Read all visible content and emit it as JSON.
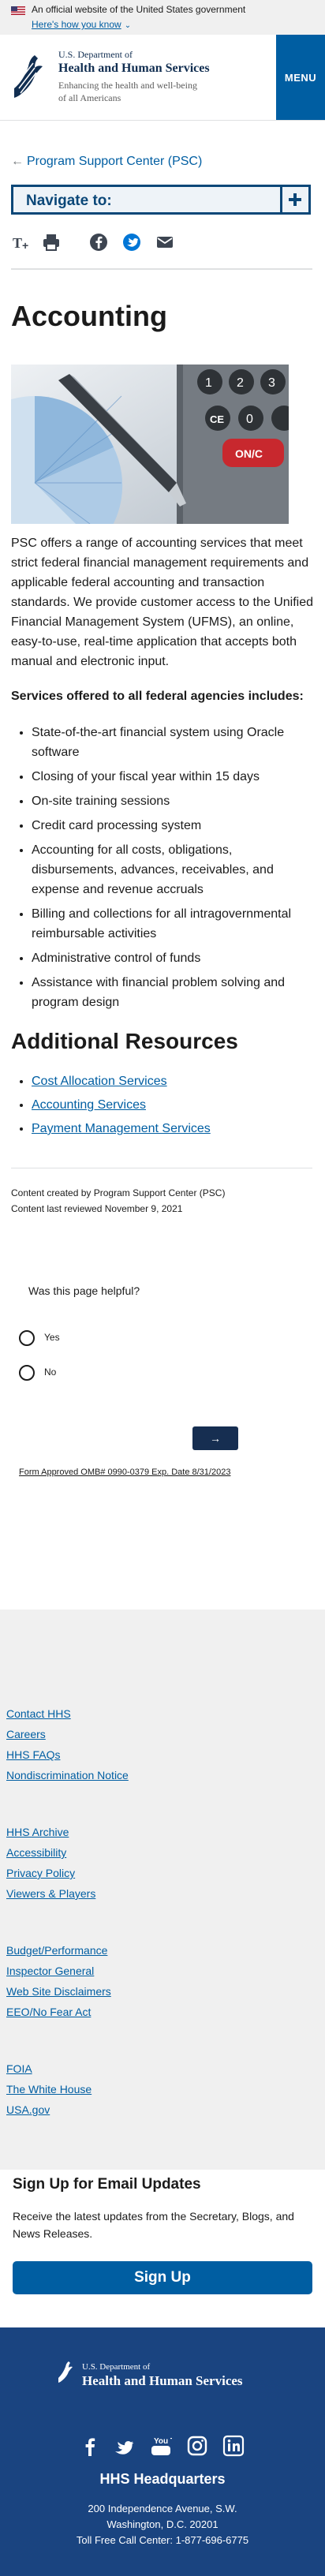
{
  "gov_banner": {
    "text": "An official website of the United States government",
    "link": "Here's how you know"
  },
  "header": {
    "dept_line1": "U.S. Department of",
    "dept_line2": "Health and Human Services",
    "tagline": "Enhancing the health and well-being of all Americans",
    "menu_label": "MENU"
  },
  "breadcrumb": {
    "label": "Program Support Center (PSC)"
  },
  "navigate": {
    "label": "Navigate to:"
  },
  "share_icons": [
    "text-size-icon",
    "print-icon",
    "facebook-icon",
    "twitter-icon",
    "email-icon"
  ],
  "main": {
    "title": "Accounting",
    "intro": "PSC offers a range of accounting services that meet strict federal financial management requirements and applicable federal accounting and transaction standards. We provide customer access to the Unified Financial Management System (UFMS), an online, easy-to-use, real-time application that accepts both manual and electronic input.",
    "services_heading": "Services offered to all federal agencies includes:",
    "services": [
      "State-of-the-art financial system using Oracle software",
      "Closing of your fiscal year within 15 days",
      "On-site training sessions",
      "Credit card processing system",
      "Accounting for all costs, obligations, disbursements, advances, receivables, and expense and revenue accruals",
      "Billing and collections for all intragovernmental reimbursable activities",
      "Administrative control of funds",
      "Assistance with financial problem solving and program design"
    ],
    "resources_heading": "Additional Resources",
    "resources": [
      "Cost Allocation Services",
      "Accounting Services",
      "Payment Management Services"
    ],
    "created_by": "Content created by Program Support Center (PSC)",
    "reviewed": "Content last reviewed November 9, 2021"
  },
  "feedback": {
    "question": "Was this page helpful?",
    "yes": "Yes",
    "no": "No",
    "next": "→",
    "omb": "Form Approved OMB# 0990-0379 Exp. Date 8/31/2023"
  },
  "footer": {
    "links": [
      "Contact HHS",
      "Careers",
      "HHS FAQs",
      "Nondiscrimination Notice",
      "HHS Archive",
      "Accessibility",
      "Privacy Policy",
      "Viewers & Players",
      "Budget/Performance",
      "Inspector General",
      "Web Site Disclaimers",
      "EEO/No Fear Act",
      "FOIA",
      "The White House",
      "USA.gov"
    ],
    "signup_heading": "Sign Up for Email Updates",
    "signup_text": "Receive the latest updates from the Secretary, Blogs, and News Releases.",
    "signup_button": "Sign Up",
    "dept_line1": "U.S. Department of",
    "dept_line2": "Health and Human Services",
    "social": [
      "facebook-icon",
      "twitter-icon",
      "youtube-icon",
      "instagram-icon",
      "linkedin-icon"
    ],
    "youtube_text": "You Tube",
    "hq_title": "HHS Headquarters",
    "address1": "200 Independence Avenue, S.W.",
    "address2": "Washington, D.C. 20201",
    "call_center": "Toll Free Call Center: 1-877-696-6775"
  },
  "colors": {
    "brand": "#005ea2",
    "dark_navy": "#162e51",
    "footer_bg": "#1a4480"
  }
}
